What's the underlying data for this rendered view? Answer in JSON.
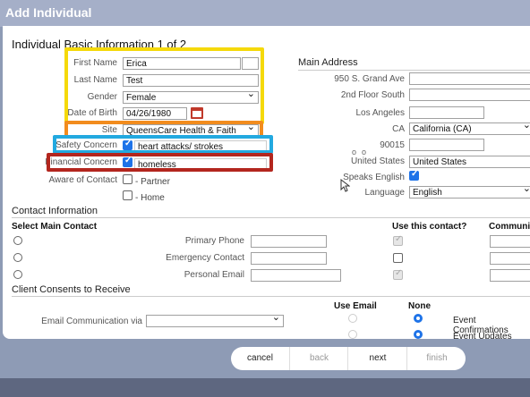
{
  "window": {
    "title": "Add Individual"
  },
  "heading": "Individual Basic Information 1 of 2",
  "basic": {
    "first_name_label": "First Name",
    "first_name": "Erica",
    "last_name_label": "Last Name",
    "last_name": "Test",
    "gender_label": "Gender",
    "gender": "Female",
    "dob_label": "Date of Birth",
    "dob": "04/26/1980",
    "site_label": "Site",
    "site": "QueensCare Health & Faith",
    "safety_label": "Safety Concern",
    "safety": "heart attacks/ strokes",
    "financial_label": "Financial Concern",
    "financial": "homeless",
    "aware_label": "Aware of Contact",
    "partner": "- Partner",
    "home": "- Home"
  },
  "address": {
    "title": "Main Address",
    "line1": "950 S. Grand Ave",
    "line2": "2nd Floor South",
    "city": "Los Angeles",
    "state_code": "CA",
    "state": "California (CA)",
    "zip": "90015",
    "country_label": "United States",
    "country": "United States",
    "speaks_english_label": "Speaks English",
    "language_label": "Language",
    "language": "English"
  },
  "contact": {
    "title": "Contact Information",
    "select_main": "Select Main Contact",
    "use_this": "Use this contact?",
    "communic": "Communic",
    "rows": [
      {
        "label": "Primary Phone"
      },
      {
        "label": "Emergency Contact"
      },
      {
        "label": "Personal Email"
      }
    ]
  },
  "consents": {
    "title": "Client Consents to Receive",
    "email_label": "Email Communication via",
    "use_email": "Use Email",
    "none": "None",
    "event_confirmations": "Event Confirmations",
    "event_updates": "Event Updates"
  },
  "buttons": {
    "cancel": "cancel",
    "back": "back",
    "next": "next",
    "finish": "finish"
  },
  "colors": {
    "yellow": "#f5d90a",
    "orange": "#f28c1e",
    "blue": "#22a9e0",
    "red": "#b3261e",
    "accent": "#1e73e8"
  }
}
